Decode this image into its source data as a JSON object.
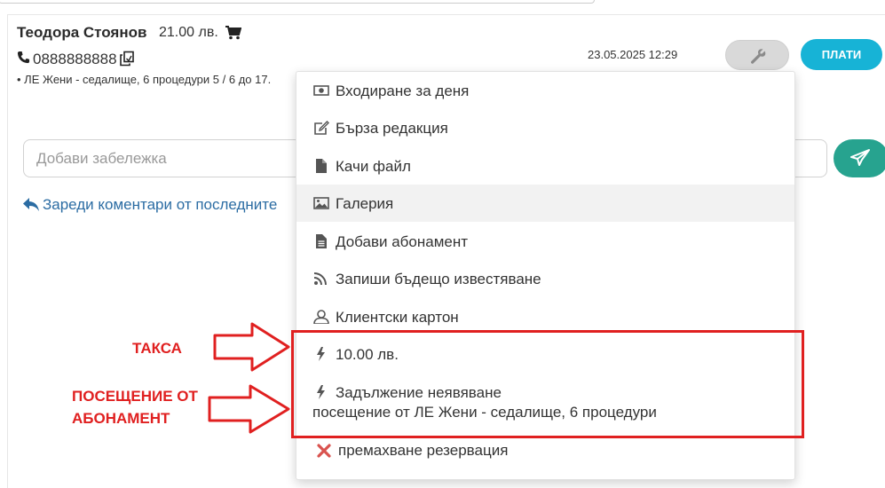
{
  "client": {
    "name": "Теодора Стоянов",
    "price": "21.00 лв.",
    "phone": "0888888888",
    "service_line": "• ЛЕ Жени - седалище, 6 процедури 5 / 6 до 17.",
    "datetime": "23.05.2025 12:29"
  },
  "actions": {
    "pay_label": "ПЛАТИ"
  },
  "note": {
    "placeholder": "Добави забележка"
  },
  "comments": {
    "load_label": "Зареди коментари от последните"
  },
  "menu": {
    "items": [
      {
        "label": "Входиране за деня",
        "icon": "money-icon"
      },
      {
        "label": "Бърза редакция",
        "icon": "edit-icon"
      },
      {
        "label": "Качи файл",
        "icon": "file-icon"
      },
      {
        "label": "Галерия",
        "icon": "image-icon"
      },
      {
        "label": "Добави абонамент",
        "icon": "document-icon"
      },
      {
        "label": "Запиши бъдещо известяване",
        "icon": "rss-icon"
      },
      {
        "label": "Клиентски картон",
        "icon": "user-icon"
      },
      {
        "label": "10.00 лв.",
        "icon": "bolt-icon"
      },
      {
        "label": "Задължение неявяване",
        "sub": "посещение от ЛЕ Жени - седалище, 6 процедури",
        "icon": "bolt-icon"
      },
      {
        "label": "премахване резервация",
        "icon": "close-icon"
      }
    ]
  },
  "annotations": {
    "fee": "ТАКСА",
    "visit_line1": "ПОСЕЩЕНИЕ ОТ",
    "visit_line2": "АБОНАМЕНТ",
    "color": "#e02020"
  },
  "colors": {
    "pay_button": "#17b3d6",
    "send_button": "#27a38f",
    "link": "#2b6ca3",
    "hover_row": "#f2f2f2"
  }
}
